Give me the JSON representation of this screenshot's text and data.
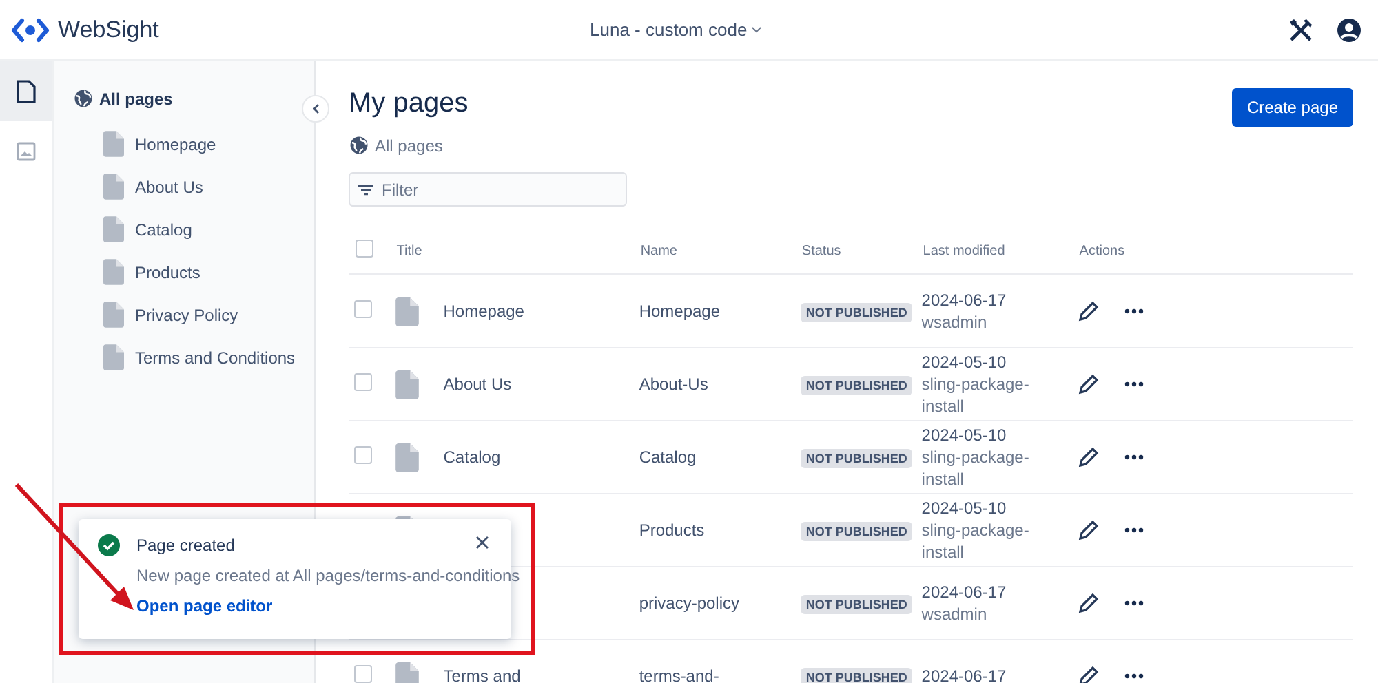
{
  "header": {
    "brand": "WebSight",
    "project": "Luna - custom code"
  },
  "rail": [
    {
      "kind": "pages",
      "selected": true
    },
    {
      "kind": "assets",
      "selected": false
    }
  ],
  "sidebar": {
    "root": "All pages",
    "items": [
      {
        "label": "Homepage"
      },
      {
        "label": "About Us"
      },
      {
        "label": "Catalog"
      },
      {
        "label": "Products"
      },
      {
        "label": "Privacy Policy"
      },
      {
        "label": "Terms and Conditions"
      }
    ]
  },
  "main": {
    "title": "My pages",
    "breadcrumb": "All pages",
    "create_button": "Create page",
    "filter": {
      "placeholder": "Filter"
    },
    "table": {
      "all_checked": false,
      "columns": [
        "Title",
        "Name",
        "Status",
        "Last modified",
        "Actions"
      ],
      "rows": [
        {
          "checked": false,
          "title": "Homepage",
          "name": "Homepage",
          "status": "NOT PUBLISHED",
          "date": "2024-06-17",
          "user": "wsadmin"
        },
        {
          "checked": false,
          "title": "About Us",
          "name": "About-Us",
          "status": "NOT PUBLISHED",
          "date": "2024-05-10",
          "user": "sling-package-install"
        },
        {
          "checked": false,
          "title": "Catalog",
          "name": "Catalog",
          "status": "NOT PUBLISHED",
          "date": "2024-05-10",
          "user": "sling-package-install"
        },
        {
          "name": "Products",
          "status": "NOT PUBLISHED",
          "date": "2024-05-10",
          "user": "sling-package-install"
        },
        {
          "name": "privacy-policy",
          "status": "NOT PUBLISHED",
          "date": "2024-06-17",
          "user": "wsadmin"
        },
        {
          "checked": false,
          "title": "Terms and",
          "name": "terms-and-",
          "status": "NOT PUBLISHED",
          "date": "2024-06-17"
        }
      ]
    }
  },
  "toast": {
    "title": "Page created",
    "message": "New page created at All pages/terms-and-conditions",
    "link": "Open page editor"
  }
}
